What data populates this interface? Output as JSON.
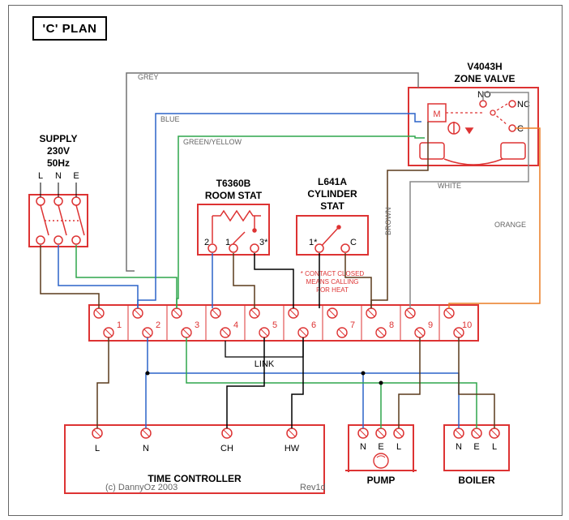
{
  "title": "'C' PLAN",
  "supply": {
    "title": "SUPPLY",
    "voltage": "230V",
    "freq": "50Hz",
    "l": "L",
    "n": "N",
    "e": "E"
  },
  "roomstat": {
    "title1": "T6360B",
    "title2": "ROOM STAT",
    "p1": "1",
    "p2": "2",
    "p3": "3*"
  },
  "cylstat": {
    "title1": "L641A",
    "title2": "CYLINDER",
    "title3": "STAT",
    "p1": "1*",
    "pC": "C",
    "note1": "* CONTACT CLOSED",
    "note2": "MEANS CALLING",
    "note3": "FOR HEAT"
  },
  "zone": {
    "title1": "V4043H",
    "title2": "ZONE VALVE",
    "m": "M",
    "no": "NO",
    "nc": "NC",
    "c": "C"
  },
  "strip": {
    "t1": "1",
    "t2": "2",
    "t3": "3",
    "t4": "4",
    "t5": "5",
    "t6": "6",
    "t7": "7",
    "t8": "8",
    "t9": "9",
    "t10": "10",
    "link": "LINK"
  },
  "timectrl": {
    "title": "TIME CONTROLLER",
    "l": "L",
    "n": "N",
    "ch": "CH",
    "hw": "HW",
    "rev": "Rev1d",
    "copy": "(c) DannyOz 2003"
  },
  "pump": {
    "title": "PUMP",
    "n": "N",
    "e": "E",
    "l": "L"
  },
  "boiler": {
    "title": "BOILER",
    "n": "N",
    "e": "E",
    "l": "L"
  },
  "wires": {
    "grey": "GREY",
    "blue": "BLUE",
    "gny": "GREEN/YELLOW",
    "brown": "BROWN",
    "white": "WHITE",
    "orange": "ORANGE"
  },
  "colors": {
    "red": "#d33",
    "blue": "#2b63c9",
    "green": "#2fa64b",
    "orange": "#ea7b22",
    "brown": "#5a3a1c",
    "grey": "#707070",
    "black": "#000"
  }
}
